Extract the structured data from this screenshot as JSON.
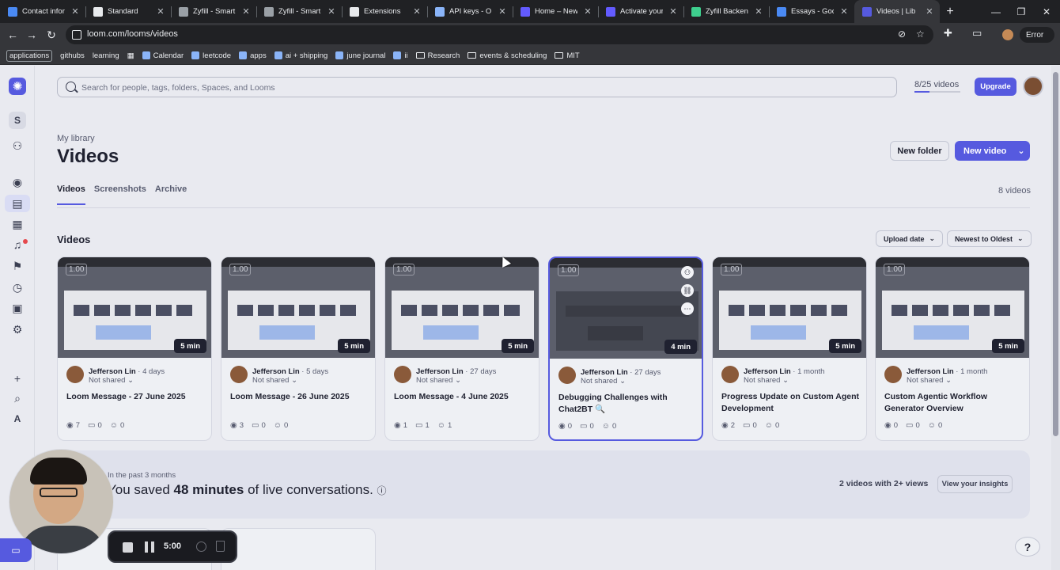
{
  "browser": {
    "tabs": [
      {
        "title": "Contact informa",
        "icon": "doc-icon",
        "color": "#4a8af4"
      },
      {
        "title": "Standard",
        "icon": "asterisk-icon",
        "color": "#e8eaed"
      },
      {
        "title": "Zyfill - Smart F",
        "icon": "globe-icon",
        "color": "#9aa0a6"
      },
      {
        "title": "Zyfill - Smart F",
        "icon": "globe-icon",
        "color": "#9aa0a6"
      },
      {
        "title": "Extensions",
        "icon": "puzzle-icon",
        "color": "#e8eaed"
      },
      {
        "title": "API keys - Oper",
        "icon": "openai-icon",
        "color": "#8ab4f8"
      },
      {
        "title": "Home – New b",
        "icon": "stripe-icon",
        "color": "#635bff"
      },
      {
        "title": "Activate your a",
        "icon": "stripe-icon",
        "color": "#635bff"
      },
      {
        "title": "Zyfill Backend",
        "icon": "supabase-icon",
        "color": "#3ecf8e"
      },
      {
        "title": "Essays - Googl",
        "icon": "docs-icon",
        "color": "#4a8af4"
      },
      {
        "title": "Videos | Lib",
        "icon": "loom-icon",
        "color": "#565adf"
      }
    ],
    "url": "loom.com/looms/videos",
    "profile_label": "Error",
    "bookmarks": [
      {
        "label": "applications",
        "style": "boxed"
      },
      {
        "label": "githubs",
        "style": "plain"
      },
      {
        "label": "learning",
        "style": "plain"
      },
      {
        "label": "Calendar",
        "style": "icon"
      },
      {
        "label": "leetcode",
        "style": "icon"
      },
      {
        "label": "apps",
        "style": "icon"
      },
      {
        "label": "ai + shipping",
        "style": "icon"
      },
      {
        "label": "june journal",
        "style": "icon"
      },
      {
        "label": "ii",
        "style": "icon"
      },
      {
        "label": "Research",
        "style": "folder"
      },
      {
        "label": "events & scheduling",
        "style": "folder"
      },
      {
        "label": "MIT",
        "style": "folder"
      }
    ]
  },
  "rail": {
    "workspace_initial": "S",
    "bottom_initial": "A"
  },
  "header": {
    "search_placeholder": "Search for people, tags, folders, Spaces, and Looms",
    "quota": "8/25 videos",
    "quota_fraction": 0.32,
    "upgrade_label": "Upgrade"
  },
  "page": {
    "breadcrumb": "My library",
    "title": "Videos",
    "new_folder_label": "New folder",
    "new_video_label": "New video",
    "tabs": [
      "Videos",
      "Screenshots",
      "Archive"
    ],
    "count": "8 videos",
    "section_title": "Videos",
    "sort_field": "Upload date",
    "sort_order": "Newest to Oldest"
  },
  "videos": [
    {
      "speed": "1.00",
      "duration": "5 min",
      "author": "Jefferson Lin",
      "age": "4 days",
      "sharing": "Not shared",
      "title": "Loom Message - 27 June 2025",
      "views": "7",
      "comments": "0",
      "reactions": "0",
      "dark": false
    },
    {
      "speed": "1.00",
      "duration": "5 min",
      "author": "Jefferson Lin",
      "age": "5 days",
      "sharing": "Not shared",
      "title": "Loom Message - 26 June 2025",
      "views": "3",
      "comments": "0",
      "reactions": "0",
      "dark": false
    },
    {
      "speed": "1.00",
      "duration": "5 min",
      "author": "Jefferson Lin",
      "age": "27 days",
      "sharing": "Not shared",
      "title": "Loom Message - 4 June 2025",
      "views": "1",
      "comments": "1",
      "reactions": "1",
      "dark": false
    },
    {
      "speed": "1.00",
      "duration": "4 min",
      "author": "Jefferson Lin",
      "age": "27 days",
      "sharing": "Not shared",
      "title": "Debugging Challenges with Chat2BT 🔍",
      "views": "0",
      "comments": "0",
      "reactions": "0",
      "dark": true
    },
    {
      "speed": "1.00",
      "duration": "5 min",
      "author": "Jefferson Lin",
      "age": "1 month",
      "sharing": "Not shared",
      "title": "Progress Update on Custom Agent Development",
      "views": "2",
      "comments": "0",
      "reactions": "0",
      "dark": false
    },
    {
      "speed": "1.00",
      "duration": "5 min",
      "author": "Jefferson Lin",
      "age": "1 month",
      "sharing": "Not shared",
      "title": "Custom Agentic Workflow Generator Overview",
      "views": "0",
      "comments": "0",
      "reactions": "0",
      "dark": false
    }
  ],
  "insights": {
    "period": "In the past 3 months",
    "prefix": "You saved",
    "amount": "48 minutes",
    "suffix": "of live conversations.",
    "views_text": "2 videos with 2+ views",
    "button_label": "View your insights"
  },
  "recorder": {
    "time": "5:00"
  },
  "help_label": "?"
}
